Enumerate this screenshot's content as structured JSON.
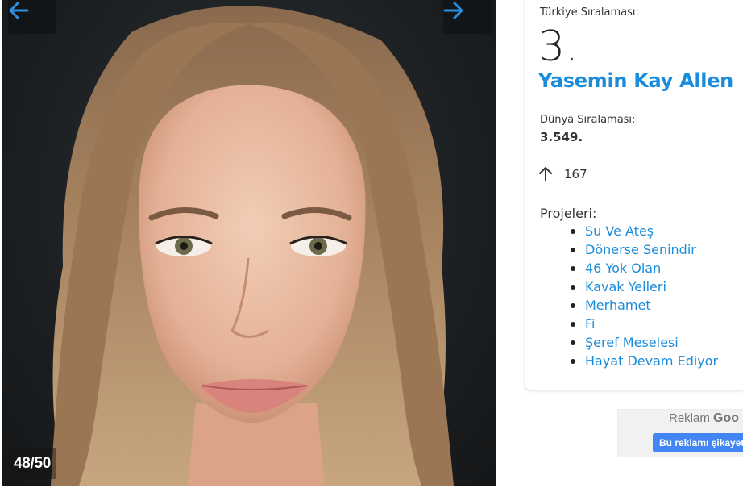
{
  "gallery": {
    "counter": "48/50",
    "prev_icon": "arrow-left-icon",
    "next_icon": "arrow-right-icon"
  },
  "profile": {
    "turkey_rank_label": "Türkiye Sıralaması:",
    "turkey_rank": "3.",
    "name": "Yasemin Kay Allen",
    "world_rank_label": "Dünya Sıralaması:",
    "world_rank": "3.549.",
    "trend_icon": "arrow-up-icon",
    "trend_value": "167",
    "projects_label": "Projeleri:",
    "projects": [
      "Su Ve Ateş",
      "Dönerse Senindir",
      "46 Yok Olan",
      "Kavak Yelleri",
      "Merhamet",
      "Fi",
      "Şeref Meselesi",
      "Hayat Devam Ediyor"
    ]
  },
  "ad": {
    "label": "Reklam",
    "brand": "Goo",
    "report_button": "Bu reklamı şikayet et"
  },
  "colors": {
    "accent": "#1a8cdb",
    "ad_button": "#4285f4"
  }
}
